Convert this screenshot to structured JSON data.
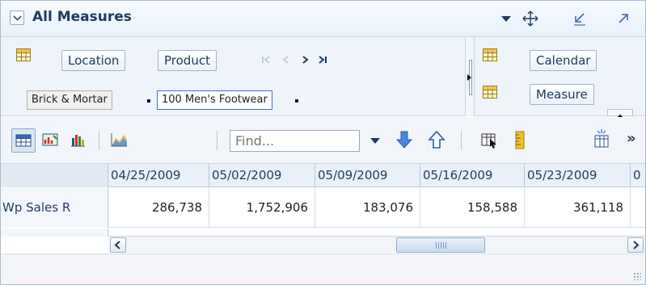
{
  "title_bar": {
    "title": "All Measures",
    "icons": [
      "collapse-chevron-icon",
      "dropdown-arrow-icon",
      "move-icon",
      "restore-icon",
      "maximize-icon"
    ]
  },
  "pivot": {
    "row_dimensions": [
      "Location",
      "Product"
    ],
    "members": [
      "Brick & Mortar",
      "100 Men's Footwear"
    ],
    "column_dimensions": [
      "Calendar",
      "Measure"
    ],
    "nav_arrows": [
      "first-page-icon",
      "previous-page-icon",
      "next-page-icon",
      "last-page-icon"
    ]
  },
  "toolbar": {
    "find_placeholder": "Find...",
    "icons": [
      "table-view-icon",
      "chart-table-view-icon",
      "bar-chart-icon",
      "area-chart-icon",
      "dropdown-icon",
      "find-next-icon",
      "find-previous-icon",
      "column-select-icon",
      "ruler-icon",
      "split-view-icon",
      "more-icon"
    ],
    "more_label": "»"
  },
  "table": {
    "columns": [
      "04/25/2009",
      "05/02/2009",
      "05/09/2009",
      "05/16/2009",
      "05/23/2009",
      "0"
    ],
    "rows": [
      {
        "label": "Wp Sales R",
        "values": [
          "286,738",
          "1,752,906",
          "183,076",
          "158,588",
          "361,118",
          ""
        ]
      }
    ]
  },
  "scrollbar": {
    "left_arrow": "<",
    "right_arrow": ">"
  },
  "colors": {
    "title_text": "#1f3a5f",
    "accent_blue": "#3c6ea8",
    "selection_border": "#3b6fd4"
  }
}
